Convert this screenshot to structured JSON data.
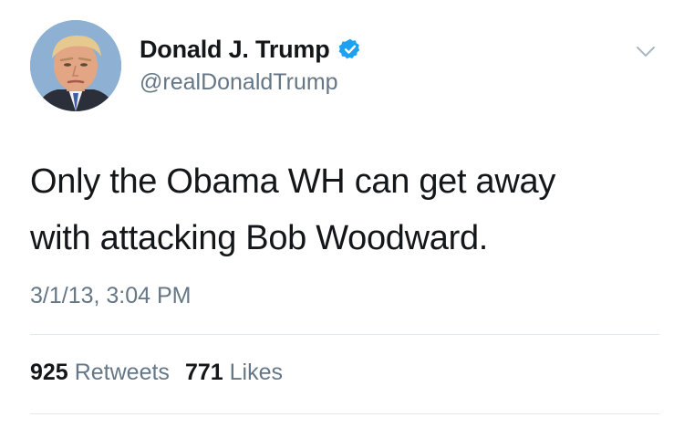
{
  "user": {
    "display_name": "Donald J. Trump",
    "handle": "@realDonaldTrump",
    "verified": true,
    "avatar_icon": "profile-photo",
    "verified_icon": "verified-badge-icon"
  },
  "menu": {
    "icon": "chevron-down-icon"
  },
  "tweet": {
    "lines": [
      "Only the Obama WH can get away",
      "with attacking Bob Woodward."
    ],
    "timestamp": "3/1/13, 3:04 PM"
  },
  "stats": {
    "retweets": {
      "count": "925",
      "label": "Retweets"
    },
    "likes": {
      "count": "771",
      "label": "Likes"
    }
  },
  "colors": {
    "text": "#14171a",
    "secondary": "#657786",
    "verified": "#1da1f2",
    "divider": "#e1e8ed"
  }
}
